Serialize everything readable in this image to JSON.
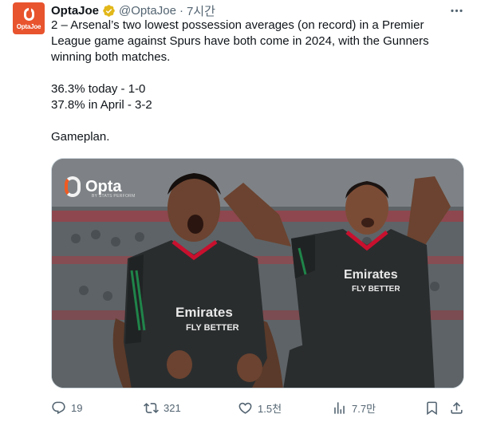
{
  "author": {
    "avatar_text": "OptaJoe",
    "display_name": "OptaJoe",
    "handle": "@OptaJoe",
    "time": "7시간",
    "verified": true
  },
  "tweet": {
    "line1": "2 – Arsenal’s two lowest possession averages (on record) in a Premier",
    "line2": "League game against Spurs have both come in 2024, with the Gunners",
    "line3": "winning both matches.",
    "stat1": "36.3% today - 1-0",
    "stat2": "37.8% in April - 3-2",
    "closing": "Gameplan."
  },
  "media": {
    "badge_word": "Opta",
    "badge_sub": "BY STATS PERFORM",
    "shirt_sponsor_1": "Emirates",
    "shirt_sponsor_2": "FLY BETTER",
    "colors": {
      "shirt": "#2a2d2e",
      "trim": "#c8102e",
      "stripe": "#1f8f4e"
    }
  },
  "actions": {
    "replies": "19",
    "retweets": "321",
    "likes": "1.5천",
    "views": "7.7만"
  },
  "icons": [
    "more-icon",
    "verified-icon",
    "reply-icon",
    "retweet-icon",
    "like-icon",
    "views-icon",
    "bookmark-icon",
    "share-icon"
  ]
}
